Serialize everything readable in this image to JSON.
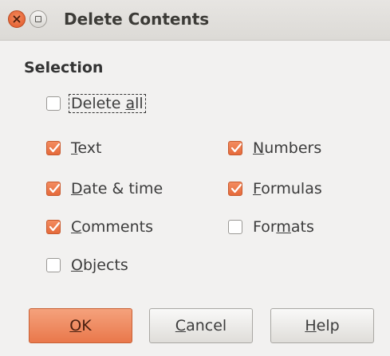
{
  "window": {
    "title": "Delete Contents"
  },
  "section": {
    "label": "Selection"
  },
  "options": {
    "delete_all": {
      "pre": "Delete ",
      "key": "a",
      "post": "ll",
      "checked": false
    },
    "text": {
      "pre": "",
      "key": "T",
      "post": "ext",
      "checked": true
    },
    "numbers": {
      "pre": "",
      "key": "N",
      "post": "umbers",
      "checked": true
    },
    "datetime": {
      "pre": "",
      "key": "D",
      "post": "ate & time",
      "checked": true
    },
    "formulas": {
      "pre": "",
      "key": "F",
      "post": "ormulas",
      "checked": true
    },
    "comments": {
      "pre": "",
      "key": "C",
      "post": "omments",
      "checked": true
    },
    "formats": {
      "pre": "For",
      "key": "m",
      "post": "ats",
      "checked": false
    },
    "objects": {
      "pre": "",
      "key": "O",
      "post": "bjects",
      "checked": false
    }
  },
  "buttons": {
    "ok": {
      "pre": "",
      "key": "O",
      "post": "K"
    },
    "cancel": {
      "pre": "",
      "key": "C",
      "post": "ancel"
    },
    "help": {
      "pre": "",
      "key": "H",
      "post": "elp"
    }
  },
  "colors": {
    "accent": "#e56a3b",
    "background": "#f2f1f0"
  }
}
